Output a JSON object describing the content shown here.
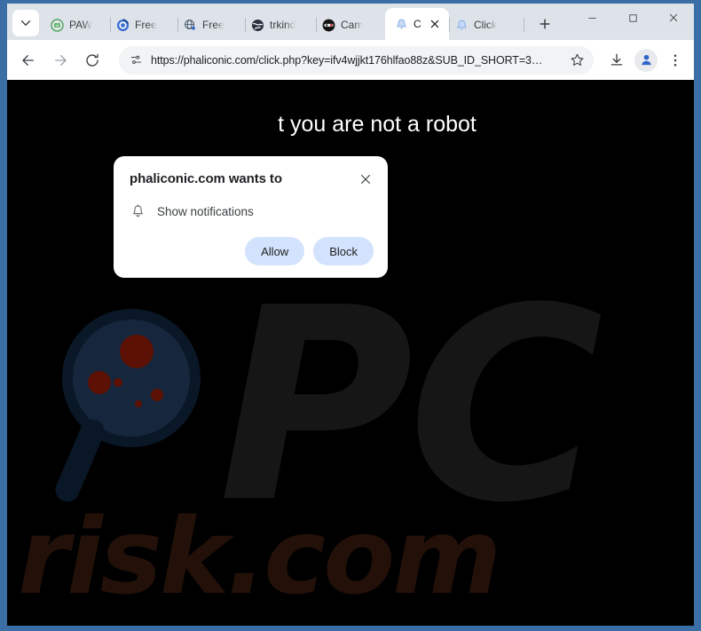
{
  "window": {
    "controls": {
      "minimize": "minimize-button",
      "maximize": "maximize-button",
      "close": "close-button"
    }
  },
  "tabstrip": {
    "tab_search_tooltip": "Search tabs",
    "new_tab_label": "+",
    "tabs": [
      {
        "title": "PAW ",
        "favicon": "green-leaf-icon",
        "active": false
      },
      {
        "title": "Free ",
        "favicon": "blue-spiral-icon",
        "active": false
      },
      {
        "title": "Free ",
        "favicon": "blue-globe-icon",
        "active": false
      },
      {
        "title": "trkind",
        "favicon": "dark-globe-icon",
        "active": false
      },
      {
        "title": "Cam ",
        "favicon": "dark-ninja-icon",
        "active": false
      },
      {
        "title": "C",
        "favicon": "blue-bell-icon",
        "active": true
      },
      {
        "title": "Click ",
        "favicon": "blue-bell-icon",
        "active": false
      }
    ]
  },
  "toolbar": {
    "back_label": "back-arrow-icon",
    "forward_label": "forward-arrow-icon",
    "reload_label": "reload-icon",
    "url": "https://phaliconic.com/click.php?key=ifv4wjjkt176hlfao88z&SUB_ID_SHORT=3…",
    "site_info_icon": "tune-sliders-icon",
    "bookmark_icon": "star-outline-icon",
    "download_icon": "download-icon",
    "profile_icon": "account-avatar-icon",
    "menu_icon": "three-dot-menu-icon"
  },
  "notification_dialog": {
    "title": "phaliconic.com wants to",
    "permission_icon": "bell-icon",
    "permission_label": "Show notifications",
    "allow_label": "Allow",
    "block_label": "Block",
    "close_label": "×",
    "button_bg": "#d3e3fd"
  },
  "page": {
    "headline": "t you are not a robot",
    "background": "#000000",
    "watermark": {
      "brand_pc": "PC",
      "brand_risk": "risk.com",
      "glass_icon": "magnifier-with-dots-icon",
      "pc_color": "#161616",
      "risk_color": "#231109"
    }
  },
  "chrome_colors": {
    "frame": "#3a6ea5",
    "tabstrip_bg": "#dee3e9",
    "toolbar_bg": "#ffffff",
    "omnibox_bg": "#f1f3f4"
  }
}
